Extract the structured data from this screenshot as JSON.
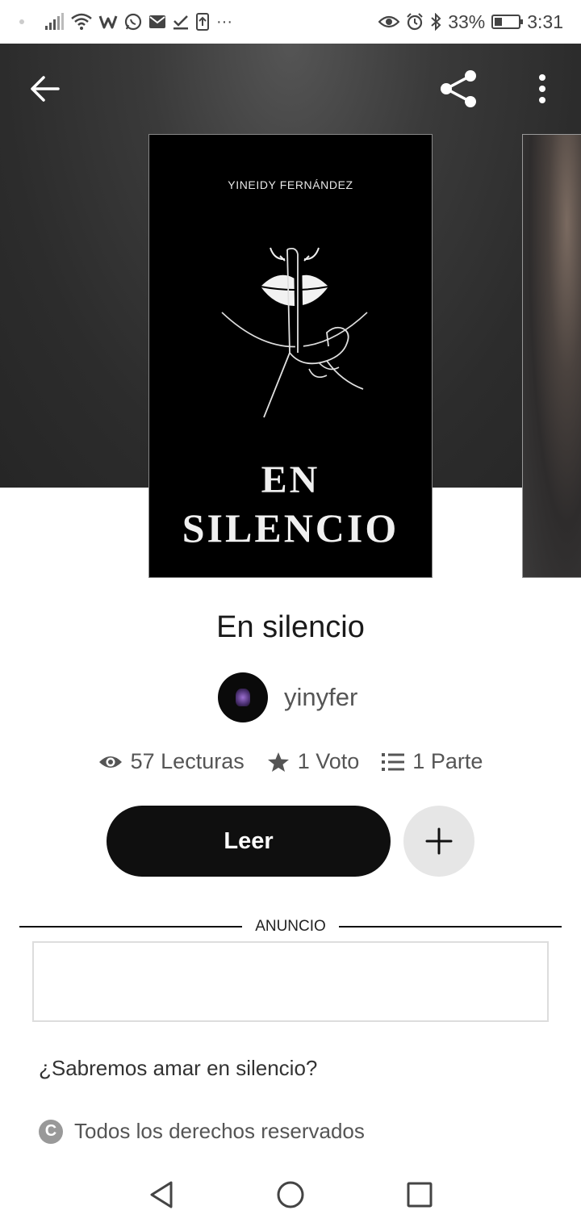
{
  "status_bar": {
    "battery_text": "33%",
    "time": "3:31",
    "battery_level": 0.33,
    "left_icons": [
      "signal-icon",
      "wifi-icon",
      "wattpad-icon",
      "whatsapp-icon",
      "mail-icon",
      "check-icon",
      "upload-icon",
      "more-dots-icon"
    ],
    "right_icons": [
      "eye-icon",
      "alarm-icon",
      "bluetooth-icon",
      "battery-icon"
    ]
  },
  "header": {
    "back_icon": "back-arrow-icon",
    "share_icon": "share-icon",
    "more_icon": "more-vertical-icon"
  },
  "cover": {
    "author": "YINEIDY FERNÁNDEZ",
    "title_line1": "EN",
    "title_line2": "SILENCIO"
  },
  "story": {
    "title": "En silencio",
    "author_name": "yinyfer"
  },
  "stats": {
    "reads": "57 Lecturas",
    "votes": "1 Voto",
    "parts": "1 Parte"
  },
  "actions": {
    "read_label": "Leer",
    "add_icon": "plus-icon"
  },
  "ad": {
    "label": "ANUNCIO"
  },
  "description": "¿Sabremos amar en silencio?",
  "rights": {
    "label": "Todos los derechos reservados",
    "icon_letter": "C"
  },
  "colors": {
    "hero_bg": "#2c2c2c",
    "primary_button": "#0f0f0f",
    "secondary_button": "#e6e6e6"
  }
}
